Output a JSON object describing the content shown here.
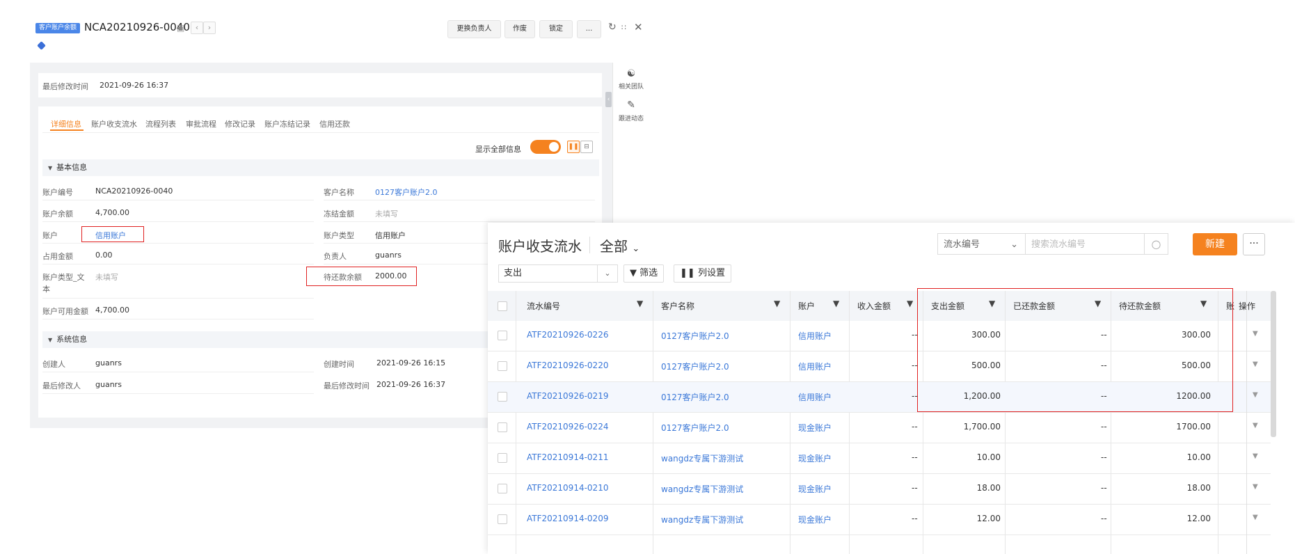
{
  "header": {
    "tag": "客户账户余额",
    "record_no": "NCA20210926-0040",
    "actions": [
      "更换负责人",
      "作废",
      "锁定",
      "..."
    ]
  },
  "top_info": {
    "label": "最后修改时间",
    "value": "2021-09-26 16:37"
  },
  "tabs": [
    "详细信息",
    "账户收支流水",
    "流程列表",
    "审批流程",
    "修改记录",
    "账户冻结记录",
    "信用还款"
  ],
  "show_all_label": "显示全部信息",
  "sections": {
    "basic_title": "基本信息",
    "system_title": "系统信息"
  },
  "basic": {
    "account_no": {
      "label": "账户编号",
      "value": "NCA20210926-0040"
    },
    "balance": {
      "label": "账户余额",
      "value": "4,700.00"
    },
    "account": {
      "label": "账户",
      "value": "信用账户"
    },
    "used": {
      "label": "占用金额",
      "value": "0.00"
    },
    "type_text": {
      "label": "账户类型_文本",
      "label_line1": "账户类型_文",
      "label_line2": "本",
      "value": "未填写"
    },
    "available": {
      "label": "账户可用金额",
      "value": "4,700.00"
    },
    "customer": {
      "label": "客户名称",
      "value": "0127客户账户2.0"
    },
    "frozen": {
      "label": "冻结金额",
      "value": "未填写"
    },
    "acc_type": {
      "label": "账户类型",
      "value": "信用账户"
    },
    "owner": {
      "label": "负责人",
      "value": "guanrs"
    },
    "repay": {
      "label": "待还款余额",
      "value": "2000.00"
    }
  },
  "system": {
    "creator": {
      "label": "创建人",
      "value": "guanrs"
    },
    "modifier": {
      "label": "最后修改人",
      "value": "guanrs"
    },
    "created": {
      "label": "创建时间",
      "value": "2021-09-26 16:15"
    },
    "modified": {
      "label": "最后修改时间",
      "value": "2021-09-26 16:37"
    }
  },
  "side": {
    "team": "相关团队",
    "follow": "跟进动态"
  },
  "flow": {
    "title": "账户收支流水",
    "scope": "全部",
    "search_field": "流水编号",
    "search_placeholder": "搜索流水编号",
    "new_label": "新建",
    "more_label": "···",
    "filter_value": "支出",
    "filter_btn": "筛选",
    "columns_btn": "列设置",
    "columns": [
      "流水编号",
      "客户名称",
      "账户",
      "收入金额",
      "支出金额",
      "已还款金额",
      "待还款金额",
      "账",
      "操作"
    ],
    "rows": [
      [
        "ATF20210926-0226",
        "0127客户账户2.0",
        "信用账户",
        "--",
        "300.00",
        "--",
        "300.00"
      ],
      [
        "ATF20210926-0220",
        "0127客户账户2.0",
        "信用账户",
        "--",
        "500.00",
        "--",
        "500.00"
      ],
      [
        "ATF20210926-0219",
        "0127客户账户2.0",
        "信用账户",
        "--",
        "1,200.00",
        "--",
        "1200.00"
      ],
      [
        "ATF20210926-0224",
        "0127客户账户2.0",
        "现金账户",
        "--",
        "1,700.00",
        "--",
        "1700.00"
      ],
      [
        "ATF20210914-0211",
        "wangdz专属下游测试",
        "现金账户",
        "--",
        "10.00",
        "--",
        "10.00"
      ],
      [
        "ATF20210914-0210",
        "wangdz专属下游测试",
        "现金账户",
        "--",
        "18.00",
        "--",
        "18.00"
      ],
      [
        "ATF20210914-0209",
        "wangdz专属下游测试",
        "现金账户",
        "--",
        "12.00",
        "--",
        "12.00"
      ]
    ]
  }
}
